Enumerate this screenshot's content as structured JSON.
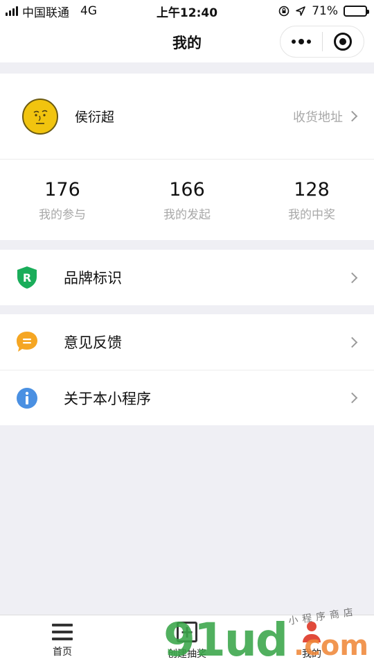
{
  "status_bar": {
    "carrier": "中国联通",
    "network": "4G",
    "time": "上午12:40",
    "battery_percent": "71%",
    "battery_level": 0.71
  },
  "nav": {
    "title": "我的",
    "more_icon": "more-dots-icon",
    "close_icon": "target-circle-icon"
  },
  "profile": {
    "username": "侯衍超",
    "address_link": "收货地址",
    "avatar_icon": "emoji-face-icon"
  },
  "stats": [
    {
      "value": "176",
      "label": "我的参与"
    },
    {
      "value": "166",
      "label": "我的发起"
    },
    {
      "value": "128",
      "label": "我的中奖"
    }
  ],
  "menu_group_1": [
    {
      "label": "品牌标识",
      "icon": "brand-shield-icon",
      "color": "#1aad5a"
    }
  ],
  "menu_group_2": [
    {
      "label": "意见反馈",
      "icon": "feedback-bubble-icon",
      "color": "#f5a623"
    },
    {
      "label": "关于本小程序",
      "icon": "info-icon",
      "color": "#4a90e2"
    }
  ],
  "tab_bar": [
    {
      "label": "首页",
      "icon": "hamburger-icon"
    },
    {
      "label": "创建抽奖",
      "icon": "plus-box-icon"
    },
    {
      "label": "我的",
      "icon": "person-icon"
    }
  ],
  "watermark": {
    "main": "91ud",
    "suffix": ".com",
    "tagline": "小程序商店"
  }
}
